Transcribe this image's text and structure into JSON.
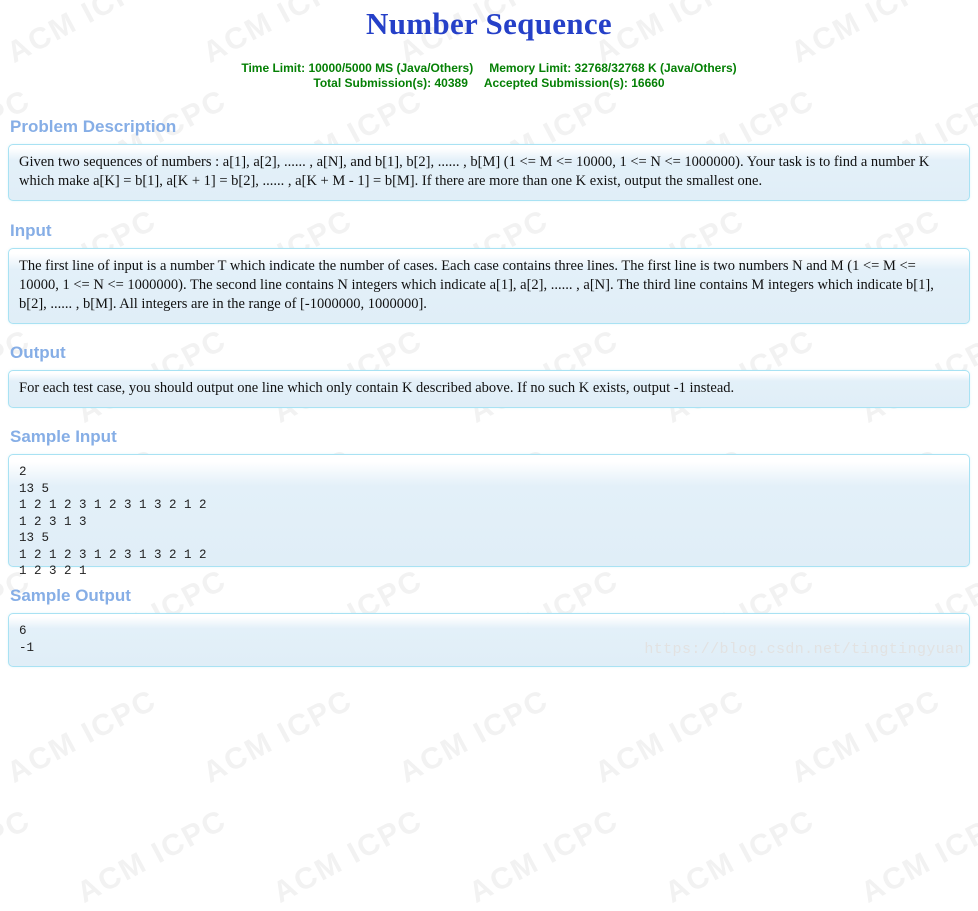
{
  "page": {
    "title": "Number Sequence",
    "background_watermark_text": "ACM ICPC",
    "site_watermark": "https://blog.csdn.net/tingtingyuan"
  },
  "colors": {
    "title": "#2540c8",
    "stats": "#058005",
    "section_heading": "#86aee6",
    "panel_border": "#a9e2f3",
    "panel_bg": "#e0eef7",
    "watermark": "#e2e2e2"
  },
  "stats": {
    "time_limit": "Time Limit: 10000/5000 MS (Java/Others)",
    "memory_limit": "Memory Limit: 32768/32768 K (Java/Others)",
    "total_submissions": "Total Submission(s): 40389",
    "accepted_submissions": "Accepted Submission(s): 16660"
  },
  "sections": {
    "description": {
      "heading": "Problem Description",
      "body": "Given two sequences of numbers : a[1], a[2], ...... , a[N], and b[1], b[2], ...... , b[M] (1 <= M <= 10000, 1 <= N <= 1000000). Your task is to find a number K which make a[K] = b[1], a[K + 1] = b[2], ...... , a[K + M - 1] = b[M]. If there are more than one K exist, output the smallest one."
    },
    "input": {
      "heading": "Input",
      "body": "The first line of input is a number T which indicate the number of cases. Each case contains three lines. The first line is two numbers N and M (1 <= M <= 10000, 1 <= N <= 1000000). The second line contains N integers which indicate a[1], a[2], ...... , a[N]. The third line contains M integers which indicate b[1], b[2], ...... , b[M]. All integers are in the range of [-1000000, 1000000]."
    },
    "output": {
      "heading": "Output",
      "body": "For each test case, you should output one line which only contain K described above. If no such K exists, output -1 instead."
    },
    "sample_input": {
      "heading": "Sample Input",
      "body": "2\n13 5\n1 2 1 2 3 1 2 3 1 3 2 1 2\n1 2 3 1 3\n13 5\n1 2 1 2 3 1 2 3 1 3 2 1 2\n1 2 3 2 1"
    },
    "sample_output": {
      "heading": "Sample Output",
      "body": "6\n-1"
    }
  }
}
